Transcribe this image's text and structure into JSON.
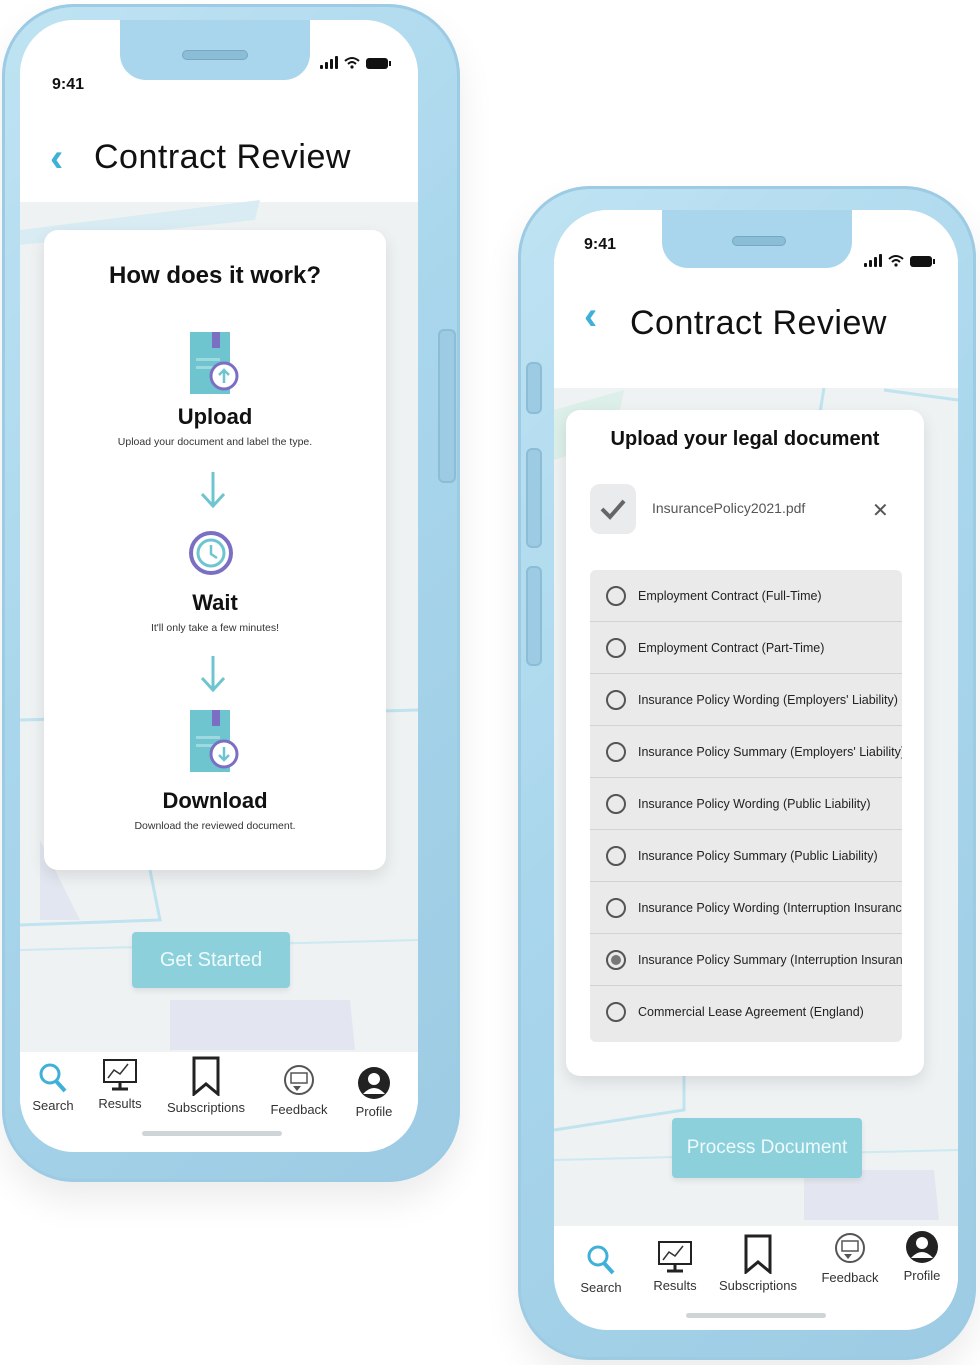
{
  "left_phone": {
    "status": {
      "time": "9:41"
    },
    "header": {
      "title": "Contract Review"
    },
    "card": {
      "heading": "How does it work?",
      "steps": [
        {
          "title": "Upload",
          "desc": "Upload your document and label the type."
        },
        {
          "title": "Wait",
          "desc": "It'll only take a few minutes!"
        },
        {
          "title": "Download",
          "desc": "Download the reviewed document."
        }
      ]
    },
    "cta_label": "Get Started",
    "tabs": [
      "Search",
      "Results",
      "Subscriptions",
      "Feedback",
      "Profile"
    ]
  },
  "right_phone": {
    "status": {
      "time": "9:41"
    },
    "header": {
      "title": "Contract Review"
    },
    "card": {
      "heading": "Upload your legal document",
      "file_name": "InsurancePolicy2021.pdf",
      "options": [
        "Employment Contract (Full-Time)",
        "Employment Contract (Part-Time)",
        "Insurance Policy Wording (Employers' Liability)",
        "Insurance Policy Summary (Employers' Liability)",
        "Insurance Policy Wording (Public Liability)",
        "Insurance Policy Summary (Public Liability)",
        "Insurance Policy Wording (Interruption Insurance)",
        "Insurance Policy Summary (Interruption Insurance)",
        "Commercial Lease Agreement (England)"
      ],
      "selected_option": "Insurance Policy Summary (Interruption Insurance)"
    },
    "cta_label": "Process Document",
    "tabs": [
      "Search",
      "Results",
      "Subscriptions",
      "Feedback",
      "Profile"
    ]
  },
  "colors": {
    "phone_frame": "#a9d6ec",
    "accent": "#3fb1d8",
    "cta": "#8cd0dc",
    "icon_teal": "#6fc5cf",
    "icon_purple": "#7b6fc4"
  }
}
